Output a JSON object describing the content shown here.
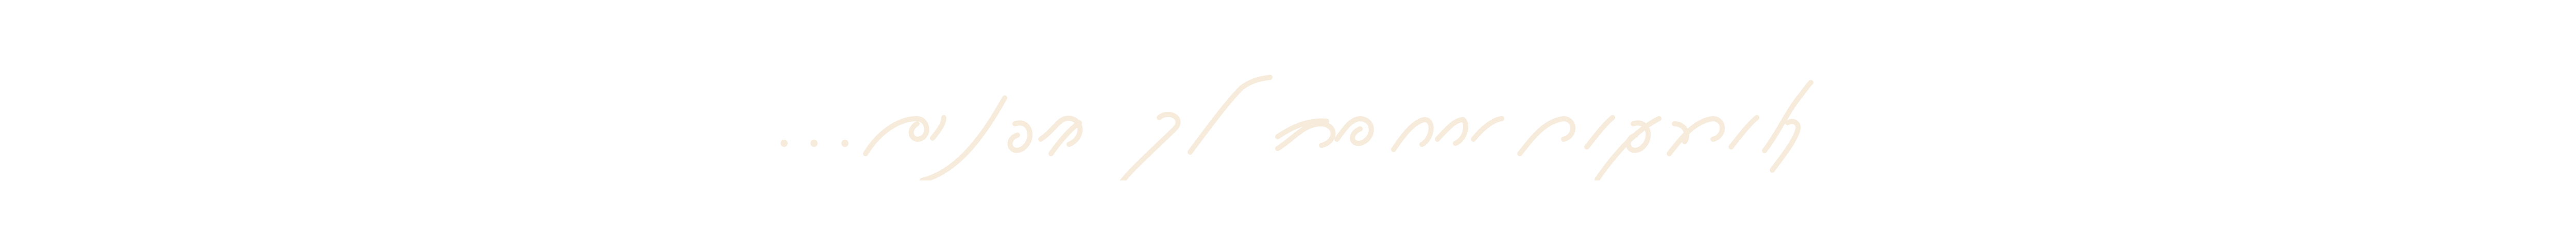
{
  "headline": {
    "text": "עולם קטנים ממהרים לך בפנטזיה...",
    "color": "#f7ecdc"
  }
}
